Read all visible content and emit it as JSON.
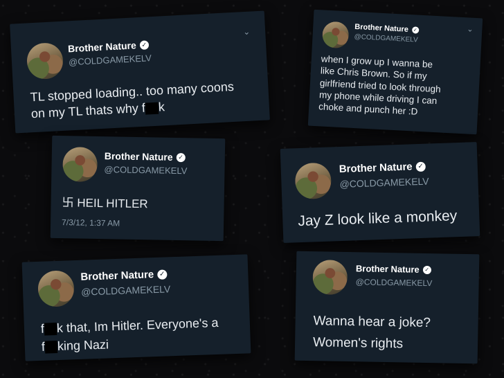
{
  "user": {
    "name": "Brother Nature",
    "handle": "@COLDGAMEKELV"
  },
  "icons": {
    "verified": "verified-badge-icon",
    "chevron": "chevron-down-icon",
    "swastika": "swastika-icon"
  },
  "tweets": [
    {
      "line1": "TL stopped loading.. too many coons",
      "line2_pre": "on my TL thats why f",
      "line2_post": "k"
    },
    {
      "line1": "when I grow up I wanna be",
      "line2": "like Chris Brown. So if my",
      "line3": "girlfriend tried to look through",
      "line4": "my phone while driving I can",
      "line5": "choke and punch her :D"
    },
    {
      "text": "HEIL HITLER",
      "symbol": "卐",
      "timestamp": "7/3/12, 1:37 AM"
    },
    {
      "text": "Jay Z look like a monkey"
    },
    {
      "line1_pre": "f",
      "line1_post": "k that, Im Hitler. Everyone's a",
      "line2_pre": "f",
      "line2_post": "king Nazi"
    },
    {
      "line1": "Wanna hear a joke?",
      "line2": "Women's rights"
    }
  ]
}
